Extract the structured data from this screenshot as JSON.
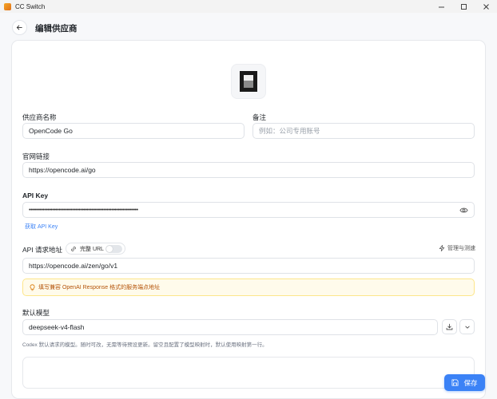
{
  "window": {
    "title": "CC Switch"
  },
  "header": {
    "title": "编辑供应商"
  },
  "form": {
    "provider_name_label": "供应商名称",
    "provider_name_value": "OpenCode Go",
    "notes_label": "备注",
    "notes_placeholder": "例如：公司专用账号",
    "website_label": "官网链接",
    "website_value": "https://opencode.ai/go",
    "api_key_label": "API Key",
    "api_key_masked": "••••••••••••••••••••••••••••••••••••••••••••••••••••••••••••••••••••••",
    "get_api_key_link": "获取 API Key",
    "endpoint_label": "API 请求地址",
    "full_url_label": "完整 URL",
    "manage_test_label": "管理与测速",
    "endpoint_value": "https://opencode.ai/zen/go/v1",
    "endpoint_hint": "填写兼容 OpenAI Response 格式的服务端点地址",
    "default_model_label": "默认模型",
    "default_model_value": "deepseek-v4-flash",
    "default_model_desc": "Codex 默认请求的模型。随时可改，无需等待预设更新。留空且配置了模型映射时，默认使用映射第一行。"
  },
  "footer": {
    "save_label": "保存"
  },
  "colors": {
    "accent": "#3b82f6",
    "hint_bg": "#fffbeb",
    "hint_text": "#b45309"
  }
}
